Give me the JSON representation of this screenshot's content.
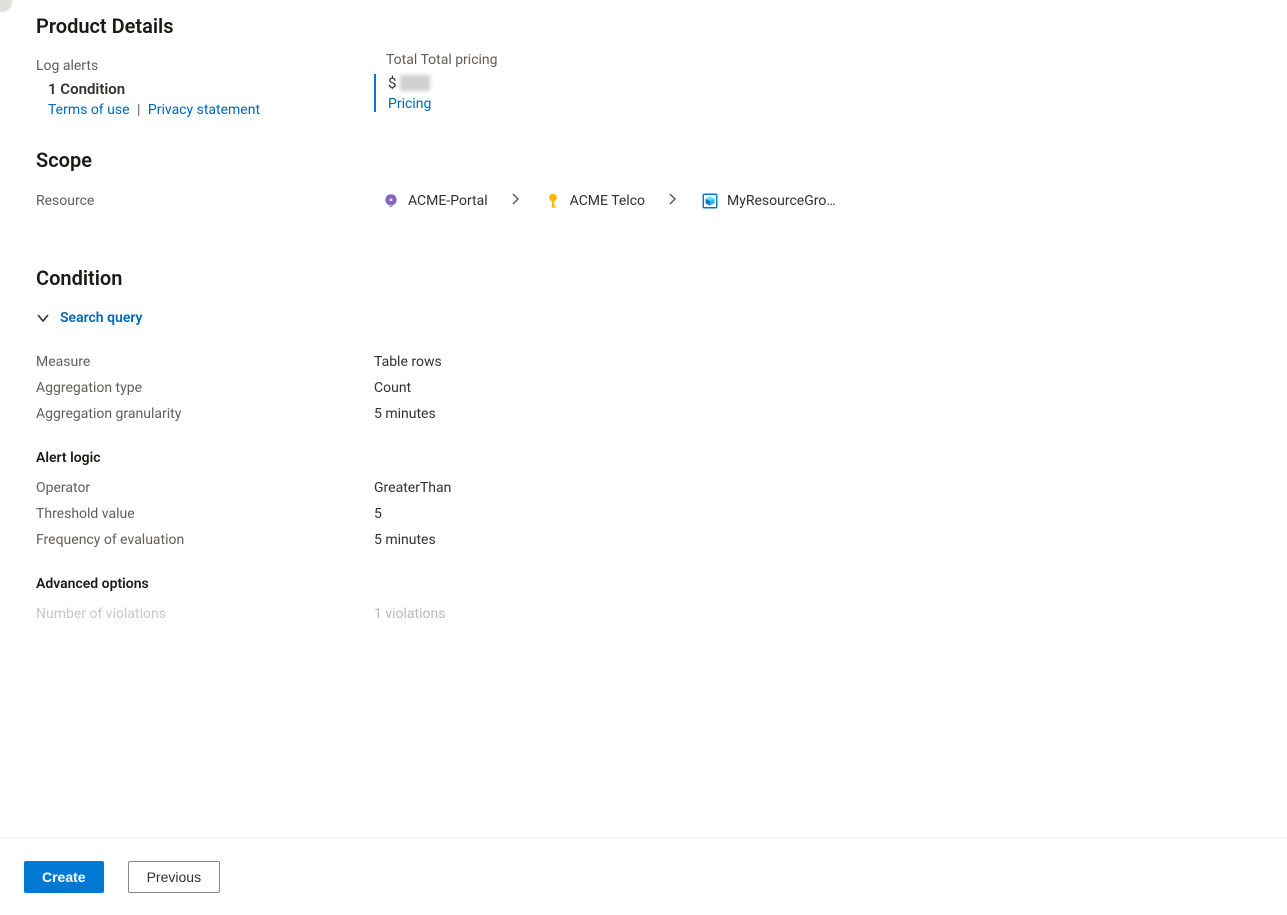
{
  "productDetails": {
    "heading": "Product Details",
    "left": {
      "label": "Log alerts",
      "conditionCount": "1 Condition",
      "termsLink": "Terms of use",
      "separator": "|",
      "privacyLink": "Privacy statement"
    },
    "right": {
      "label": "Total Total pricing",
      "currency": "$",
      "pricingLink": "Pricing"
    }
  },
  "scope": {
    "heading": "Scope",
    "label": "Resource",
    "crumbs": {
      "c1": "ACME-Portal",
      "c2": "ACME Telco",
      "c3": "MyResourceGro…"
    }
  },
  "condition": {
    "heading": "Condition",
    "expander": "Search query",
    "rows": {
      "measureLabel": "Measure",
      "measureValue": "Table rows",
      "aggTypeLabel": "Aggregation type",
      "aggTypeValue": "Count",
      "aggGranLabel": "Aggregation granularity",
      "aggGranValue": "5 minutes"
    },
    "alertLogic": {
      "heading": "Alert logic",
      "operatorLabel": "Operator",
      "operatorValue": "GreaterThan",
      "thresholdLabel": "Threshold value",
      "thresholdValue": "5",
      "freqLabel": "Frequency of evaluation",
      "freqValue": "5 minutes"
    },
    "advanced": {
      "heading": "Advanced options",
      "violationsLabel": "Number of violations",
      "violationsValue": "1 violations"
    }
  },
  "footer": {
    "create": "Create",
    "previous": "Previous"
  }
}
